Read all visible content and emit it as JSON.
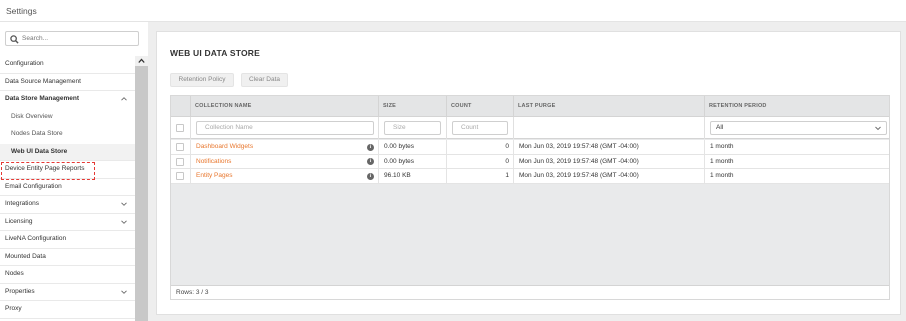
{
  "app": {
    "title": "Settings"
  },
  "search": {
    "placeholder": "Search..."
  },
  "sidebar": {
    "items": [
      {
        "label": "Configuration"
      },
      {
        "label": "Data Source Management"
      },
      {
        "label": "Data Store Management"
      },
      {
        "label": "Disk Overview"
      },
      {
        "label": "Nodes Data Store"
      },
      {
        "label": "Web UI Data Store"
      },
      {
        "label": "Device Entity Page Reports"
      },
      {
        "label": "Email Configuration"
      },
      {
        "label": "Integrations"
      },
      {
        "label": "Licensing"
      },
      {
        "label": "LiveNA Configuration"
      },
      {
        "label": "Mounted Data"
      },
      {
        "label": "Nodes"
      },
      {
        "label": "Properties"
      },
      {
        "label": "Proxy"
      }
    ]
  },
  "main": {
    "title": "WEB UI DATA STORE",
    "buttons": {
      "retention": "Retention Policy",
      "clear": "Clear Data"
    },
    "columns": [
      "COLLECTION NAME",
      "SIZE",
      "COUNT",
      "LAST PURGE",
      "RETENTION PERIOD"
    ],
    "filters": {
      "collection_placeholder": "Collection Name",
      "size_placeholder": "Size",
      "count_placeholder": "Count",
      "retention_selected": "All"
    },
    "rows": [
      {
        "name": "Dashboard Widgets",
        "size": "0.00 bytes",
        "count": "0",
        "last_purge": "Mon Jun 03, 2019 19:57:48 (GMT -04:00)",
        "retention": "1 month"
      },
      {
        "name": "Notifications",
        "size": "0.00 bytes",
        "count": "0",
        "last_purge": "Mon Jun 03, 2019 19:57:48 (GMT -04:00)",
        "retention": "1 month"
      },
      {
        "name": "Entity Pages",
        "size": "96.10 KB",
        "count": "1",
        "last_purge": "Mon Jun 03, 2019 19:57:48 (GMT -04:00)",
        "retention": "1 month"
      }
    ],
    "info_glyph": "i",
    "footer": "Rows: 3 / 3"
  },
  "colors": {
    "accent": "#e8772e",
    "selection_outline": "#e53935"
  }
}
